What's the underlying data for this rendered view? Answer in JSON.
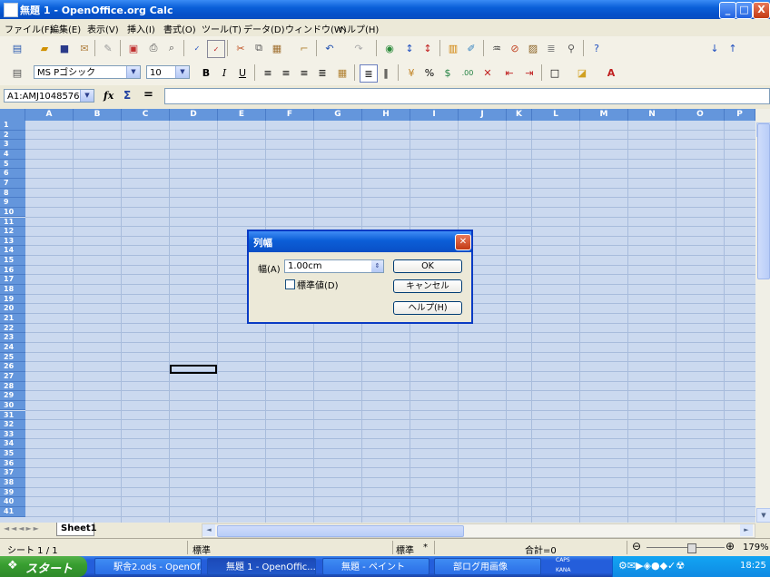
{
  "window": {
    "title": "無題 1 - OpenOffice.org Calc",
    "min": "_",
    "max": "□",
    "close": "X"
  },
  "menu": [
    "ファイル(F)",
    "編集(E)",
    "表示(V)",
    "挿入(I)",
    "書式(O)",
    "ツール(T)",
    "データ(D)",
    "ウィンドウ(W)",
    "ヘルプ(H)"
  ],
  "toolbar": {
    "search_placeholder": "検索"
  },
  "format": {
    "font_name": "MS Pゴシック",
    "font_size": "10",
    "bold": "B",
    "italic": "I",
    "underline": "U"
  },
  "formula": {
    "name_box": "A1:AMJ1048576",
    "function_icon": "fx",
    "sum_icon": "Σ",
    "equals": "="
  },
  "columns": [
    "A",
    "B",
    "C",
    "D",
    "E",
    "F",
    "G",
    "H",
    "I",
    "J",
    "K",
    "L",
    "M",
    "N",
    "O",
    "P"
  ],
  "rows": [
    "1",
    "2",
    "3",
    "4",
    "5",
    "6",
    "7",
    "8",
    "9",
    "10",
    "11",
    "12",
    "13",
    "14",
    "15",
    "16",
    "17",
    "18",
    "19",
    "20",
    "21",
    "22",
    "23",
    "24",
    "25",
    "26",
    "27",
    "28",
    "29",
    "30",
    "31",
    "32",
    "33",
    "34",
    "35",
    "36",
    "37",
    "38",
    "39",
    "40",
    "41"
  ],
  "sheet_tab": "Sheet1",
  "status": {
    "sheet": "シート 1 / 1",
    "style": "標準",
    "mode": "標準",
    "star": "*",
    "sum": "合計=0",
    "zoom": "179%"
  },
  "dialog": {
    "title": "列幅",
    "width_label": "幅(A)",
    "width_value": "1.00cm",
    "default_label": "標準値(D)",
    "default_checked": false,
    "ok": "OK",
    "cancel": "キャンセル",
    "help": "ヘルプ(H)"
  },
  "taskbar": {
    "start": "スタート",
    "tasks": [
      "駅舎2.ods - OpenOf...",
      "無題 1 - OpenOffic...",
      "無題 - ペイント",
      "部ログ用画像"
    ],
    "tray_caps": "CAPS",
    "tray_kana": "KANA",
    "clock": "18:25"
  }
}
